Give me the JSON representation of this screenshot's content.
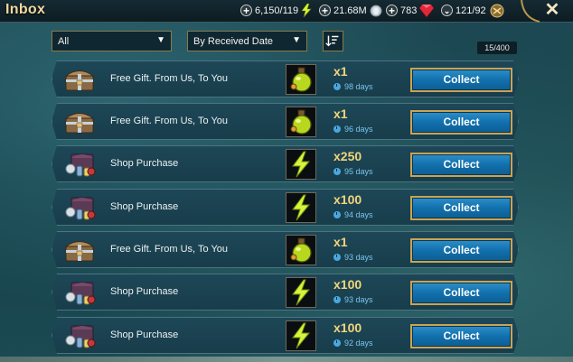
{
  "header": {
    "title": "Inbox",
    "energy": "6,150/119",
    "silver": "21.68M",
    "gems": "783",
    "slots": "121/92",
    "close_icon": "✕"
  },
  "filters": {
    "type_filter": "All",
    "sort_filter": "By Received Date",
    "count": "15/400"
  },
  "rows": [
    {
      "sender": "Free Gift. From Us, To You",
      "sender_icon": "gift-chest-icon",
      "item_icon": "potion-icon",
      "qty": "x1",
      "days": "98 days",
      "button": "Collect"
    },
    {
      "sender": "Free Gift. From Us, To You",
      "sender_icon": "gift-chest-icon",
      "item_icon": "potion-icon",
      "qty": "x1",
      "days": "96 days",
      "button": "Collect"
    },
    {
      "sender": "Shop Purchase",
      "sender_icon": "shop-bundle-icon",
      "item_icon": "energy-icon",
      "qty": "x250",
      "days": "95 days",
      "button": "Collect"
    },
    {
      "sender": "Shop Purchase",
      "sender_icon": "shop-bundle-icon",
      "item_icon": "energy-icon",
      "qty": "x100",
      "days": "94 days",
      "button": "Collect"
    },
    {
      "sender": "Free Gift. From Us, To You",
      "sender_icon": "gift-chest-icon",
      "item_icon": "potion-icon",
      "qty": "x1",
      "days": "93 days",
      "button": "Collect"
    },
    {
      "sender": "Shop Purchase",
      "sender_icon": "shop-bundle-icon",
      "item_icon": "energy-icon",
      "qty": "x100",
      "days": "93 days",
      "button": "Collect"
    },
    {
      "sender": "Shop Purchase",
      "sender_icon": "shop-bundle-icon",
      "item_icon": "energy-icon",
      "qty": "x100",
      "days": "92 days",
      "button": "Collect"
    }
  ],
  "colors": {
    "accent_gold": "#c9a455",
    "button_blue": "#1170ad",
    "qty_gold": "#f3d57a",
    "days_blue": "#79c4ef"
  }
}
